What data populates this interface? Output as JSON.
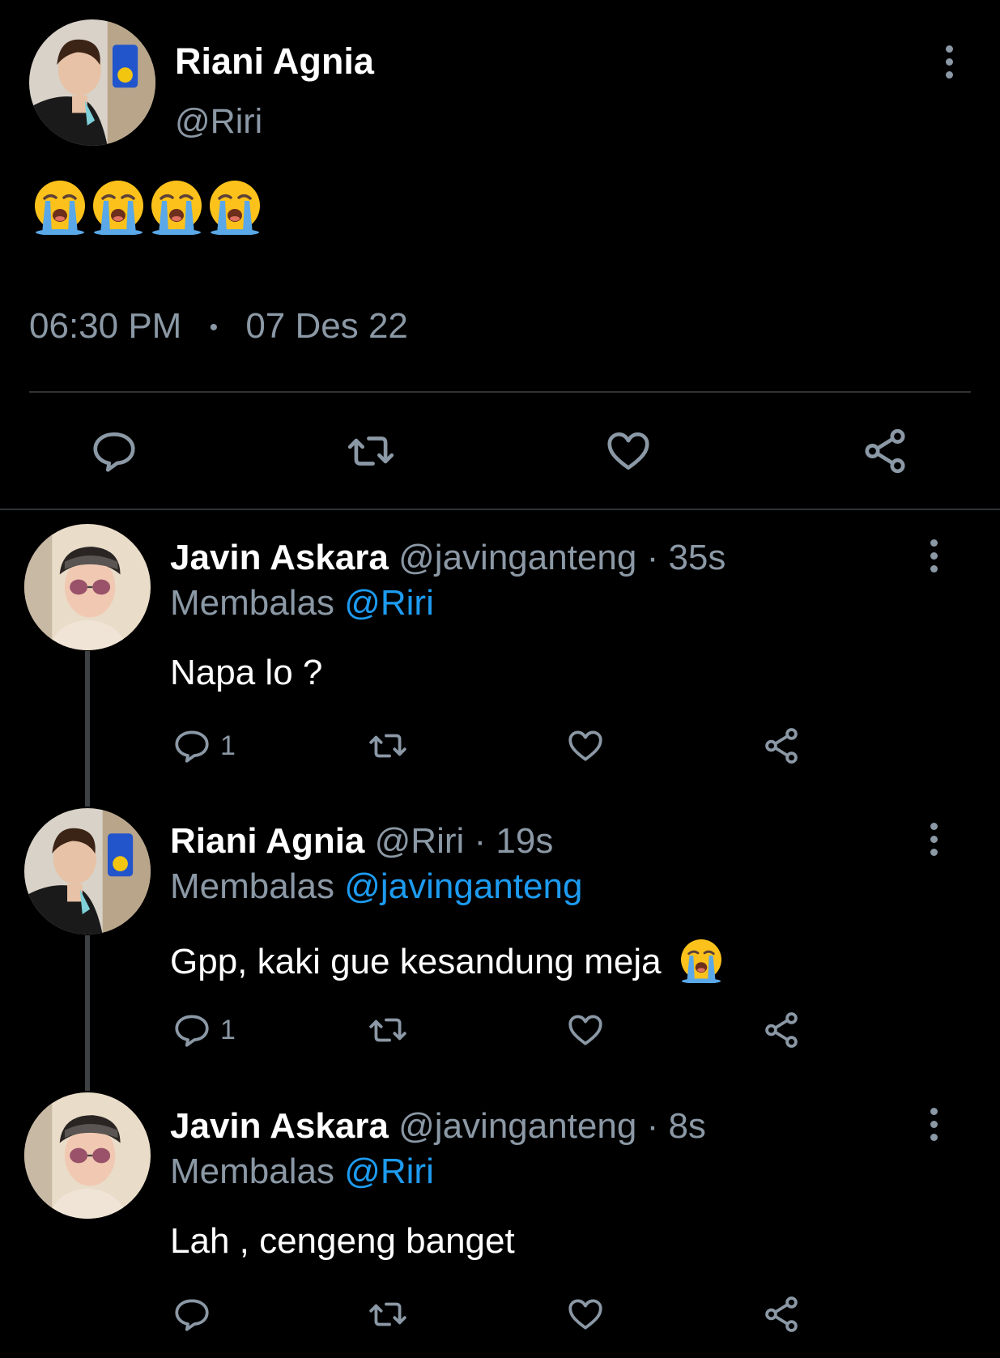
{
  "main_tweet": {
    "author_name": "Riani Agnia",
    "author_handle": "@Riri",
    "time": "06:30 PM",
    "separator": "•",
    "date": "07 Des 22",
    "emoji": [
      "loudly-crying-face",
      "loudly-crying-face",
      "loudly-crying-face",
      "loudly-crying-face"
    ]
  },
  "replies": [
    {
      "author_name": "Javin Askara",
      "author_handle": "@javinganteng",
      "time": "· 35s",
      "replying_prefix": "Membalas",
      "replying_to": "@Riri",
      "text": "Napa lo ?",
      "reply_count": "1"
    },
    {
      "author_name": "Riani Agnia",
      "author_handle": "@Riri",
      "time": "· 19s",
      "replying_prefix": "Membalas",
      "replying_to": "@javinganteng",
      "text": "Gpp, kaki gue kesandung meja",
      "reply_count": "1"
    },
    {
      "author_name": "Javin Askara",
      "author_handle": "@javinganteng",
      "time": "· 8s",
      "replying_prefix": "Membalas",
      "replying_to": "@Riri",
      "text": "Lah , cengeng banget",
      "reply_count": ""
    }
  ],
  "colors": {
    "background": "#000000",
    "text": "#ffffff",
    "secondary": "#8b98a5",
    "link": "#1d9bf0",
    "emoji_face": "#fcc21b",
    "emoji_tears": "#5aa8e8"
  }
}
